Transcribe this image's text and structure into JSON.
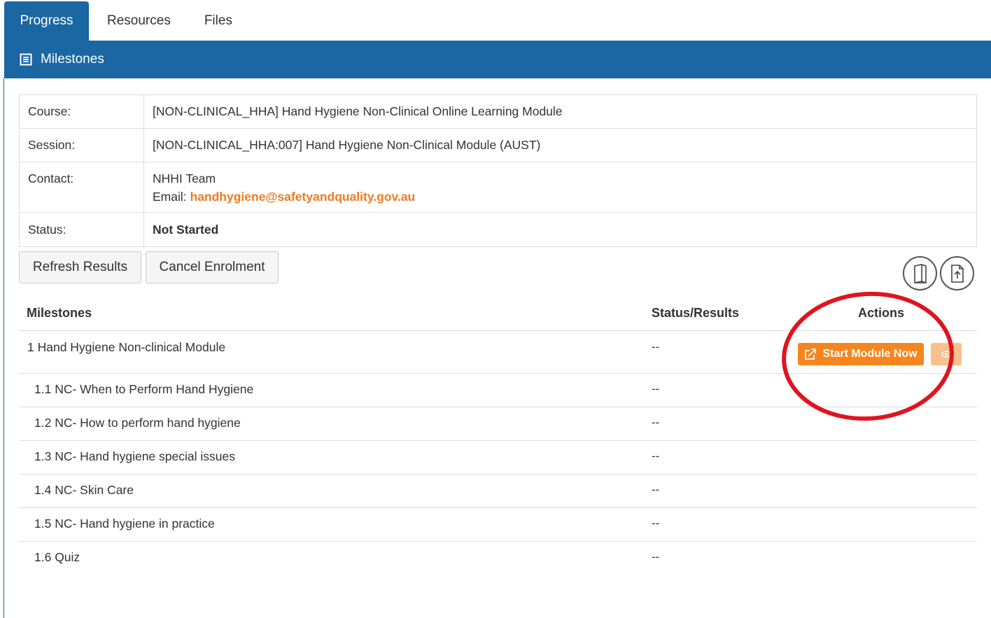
{
  "tabs": [
    {
      "label": "Progress",
      "active": true
    },
    {
      "label": "Resources",
      "active": false
    },
    {
      "label": "Files",
      "active": false
    }
  ],
  "panel": {
    "title": "Milestones",
    "icon": "list-icon"
  },
  "info": {
    "course": {
      "label": "Course:",
      "value": "[NON-CLINICAL_HHA] Hand Hygiene Non-Clinical Online Learning Module"
    },
    "session": {
      "label": "Session:",
      "value": "[NON-CLINICAL_HHA:007] Hand Hygiene Non-Clinical Module (AUST)"
    },
    "contact": {
      "label": "Contact:",
      "name": "NHHI Team",
      "email_label": "Email:",
      "email": "handhygiene@safetyandquality.gov.au"
    },
    "status": {
      "label": "Status:",
      "value": "Not Started"
    }
  },
  "buttons": {
    "refresh": "Refresh Results",
    "cancel": "Cancel Enrolment"
  },
  "icon_buttons": [
    "book-icon",
    "upload-icon"
  ],
  "milestones": {
    "headers": {
      "milestones": "Milestones",
      "status": "Status/Results",
      "actions": "Actions"
    },
    "rows": [
      {
        "name": "1 Hand Hygiene Non-clinical Module",
        "status": "--"
      },
      {
        "name": "1.1 NC- When to Perform Hand Hygiene",
        "status": "--"
      },
      {
        "name": "1.2 NC- How to perform hand hygiene",
        "status": "--"
      },
      {
        "name": "1.3 NC- Hand hygiene special issues",
        "status": "--"
      },
      {
        "name": "1.4 NC- Skin Care",
        "status": "--"
      },
      {
        "name": "1.5 NC- Hand hygiene in practice",
        "status": "--"
      },
      {
        "name": "1.6 Quiz",
        "status": "--"
      }
    ],
    "start_button": "Start Module Now"
  },
  "colors": {
    "primary": "#1a67a3",
    "accent": "#f7851e",
    "annotation": "#e0141e"
  }
}
